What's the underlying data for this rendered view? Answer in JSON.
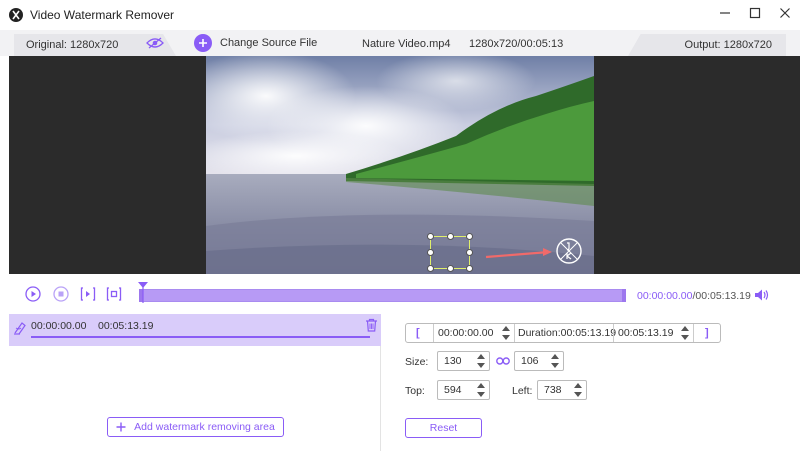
{
  "window": {
    "title": "Video Watermark Remover",
    "icon": "app-logo-icon"
  },
  "infobar": {
    "original_label": "Original: 1280x720",
    "change_source_label": "Change Source File",
    "file_name": "Nature Video.mp4",
    "file_info": "1280x720/00:05:13",
    "output_label": "Output: 1280x720"
  },
  "timeline": {
    "current_time": "00:00:00.00",
    "total_time": "/00:05:13.19"
  },
  "segment": {
    "start": "00:00:00.00",
    "end": "00:05:13.19"
  },
  "left_panel": {
    "add_area_label": "Add watermark removing area"
  },
  "range": {
    "open_bracket": "[",
    "start": "00:00:00.00",
    "duration": "Duration:00:05:13.19",
    "end": "00:05:13.19",
    "close_bracket": "]"
  },
  "area": {
    "size_label": "Size:",
    "width": "130",
    "height": "106",
    "top_label": "Top:",
    "top": "594",
    "left_label": "Left:",
    "left": "738",
    "reset_label": "Reset"
  },
  "colors": {
    "accent": "#8a5cf6",
    "segment_bg": "#d9ccfa",
    "selection": "#e0ef6a",
    "arrow": "#f06a6a"
  }
}
